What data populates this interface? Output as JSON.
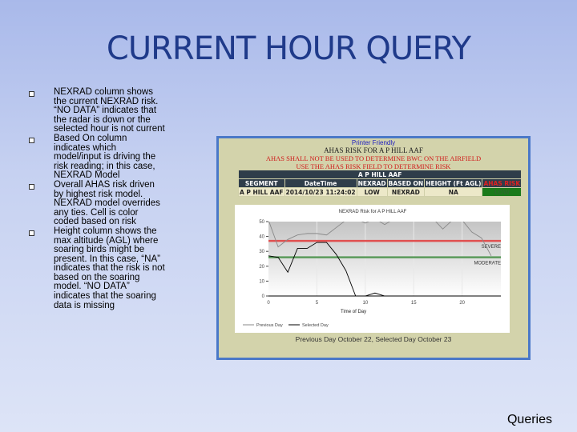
{
  "slide": {
    "title": "CURRENT HOUR QUERY",
    "footer": "Queries",
    "bullets": [
      "NEXRAD column shows the current NEXRAD risk. “NO DATA” indicates that the radar is down or the selected hour is not current",
      "Based On column indicates which model/input is driving the risk reading; in this case, NEXRAD Model",
      "Overall AHAS risk driven by highest risk model. NEXRAD model overrides any ties. Cell is color coded based on risk",
      "Height column shows the max altitude (AGL) where soaring birds might be present. In this case, “NA” indicates that the risk is not based on the soaring model. “NO DATA” indicates that the soaring data is missing"
    ]
  },
  "screenshot": {
    "printer_link": "Printer Friendly",
    "risk_title": "AHAS RISK FOR A P HILL AAF",
    "warning1": "AHAS SHALL NOT BE USED TO DETERMINE BWC ON THE AIRFIELD",
    "warning2": "USE THE AHAS RISK FIELD TO DETERMINE RISK",
    "table": {
      "caption": "A P HILL AAF",
      "headers": [
        "SEGMENT",
        "DateTime",
        "NEXRAD",
        "BASED ON",
        "HEIGHT (Ft AGL)",
        "AHAS RISK"
      ],
      "row": [
        "A P HILL AAF",
        "2014/10/23 11:24:02",
        "LOW",
        "NEXRAD",
        "NA",
        "LOW"
      ],
      "risk_color": "#1a7a1a"
    },
    "caption": "Previous Day   October 22, Selected Day   October 23"
  },
  "chart_data": {
    "type": "line",
    "title": "NEXRAD Risk for A P HILL AAF",
    "xlabel": "Time of Day",
    "ylabel": "",
    "xlim": [
      0,
      24
    ],
    "ylim": [
      0,
      50
    ],
    "xticks": [
      0,
      5,
      10,
      15,
      20
    ],
    "yticks": [
      0,
      10,
      20,
      30,
      40,
      50
    ],
    "grid": true,
    "legend": "bottom-left",
    "series": [
      {
        "name": "Previous Day",
        "color": "#888888",
        "x": [
          0,
          1,
          2,
          3,
          4,
          5,
          6,
          7,
          8,
          9,
          10,
          11,
          12,
          13,
          17,
          18,
          19,
          20,
          21,
          22,
          23
        ],
        "y": [
          51,
          33,
          38,
          41,
          42,
          42,
          41,
          46,
          51,
          52,
          49,
          52,
          48,
          52,
          52,
          45,
          51,
          51,
          43,
          39,
          27
        ]
      },
      {
        "name": "Selected Day",
        "color": "#000000",
        "x": [
          0,
          1,
          2,
          3,
          4,
          5,
          6,
          7,
          8,
          9,
          10,
          11,
          12
        ],
        "y": [
          27,
          26,
          16,
          32,
          32,
          36,
          36,
          28,
          17,
          0,
          0,
          2,
          0
        ]
      }
    ],
    "thresholds": [
      {
        "label": "SEVERE",
        "value": 37,
        "color": "#e05050"
      },
      {
        "label": "MODERATE",
        "value": 26,
        "color": "#5a9a5a"
      }
    ]
  }
}
